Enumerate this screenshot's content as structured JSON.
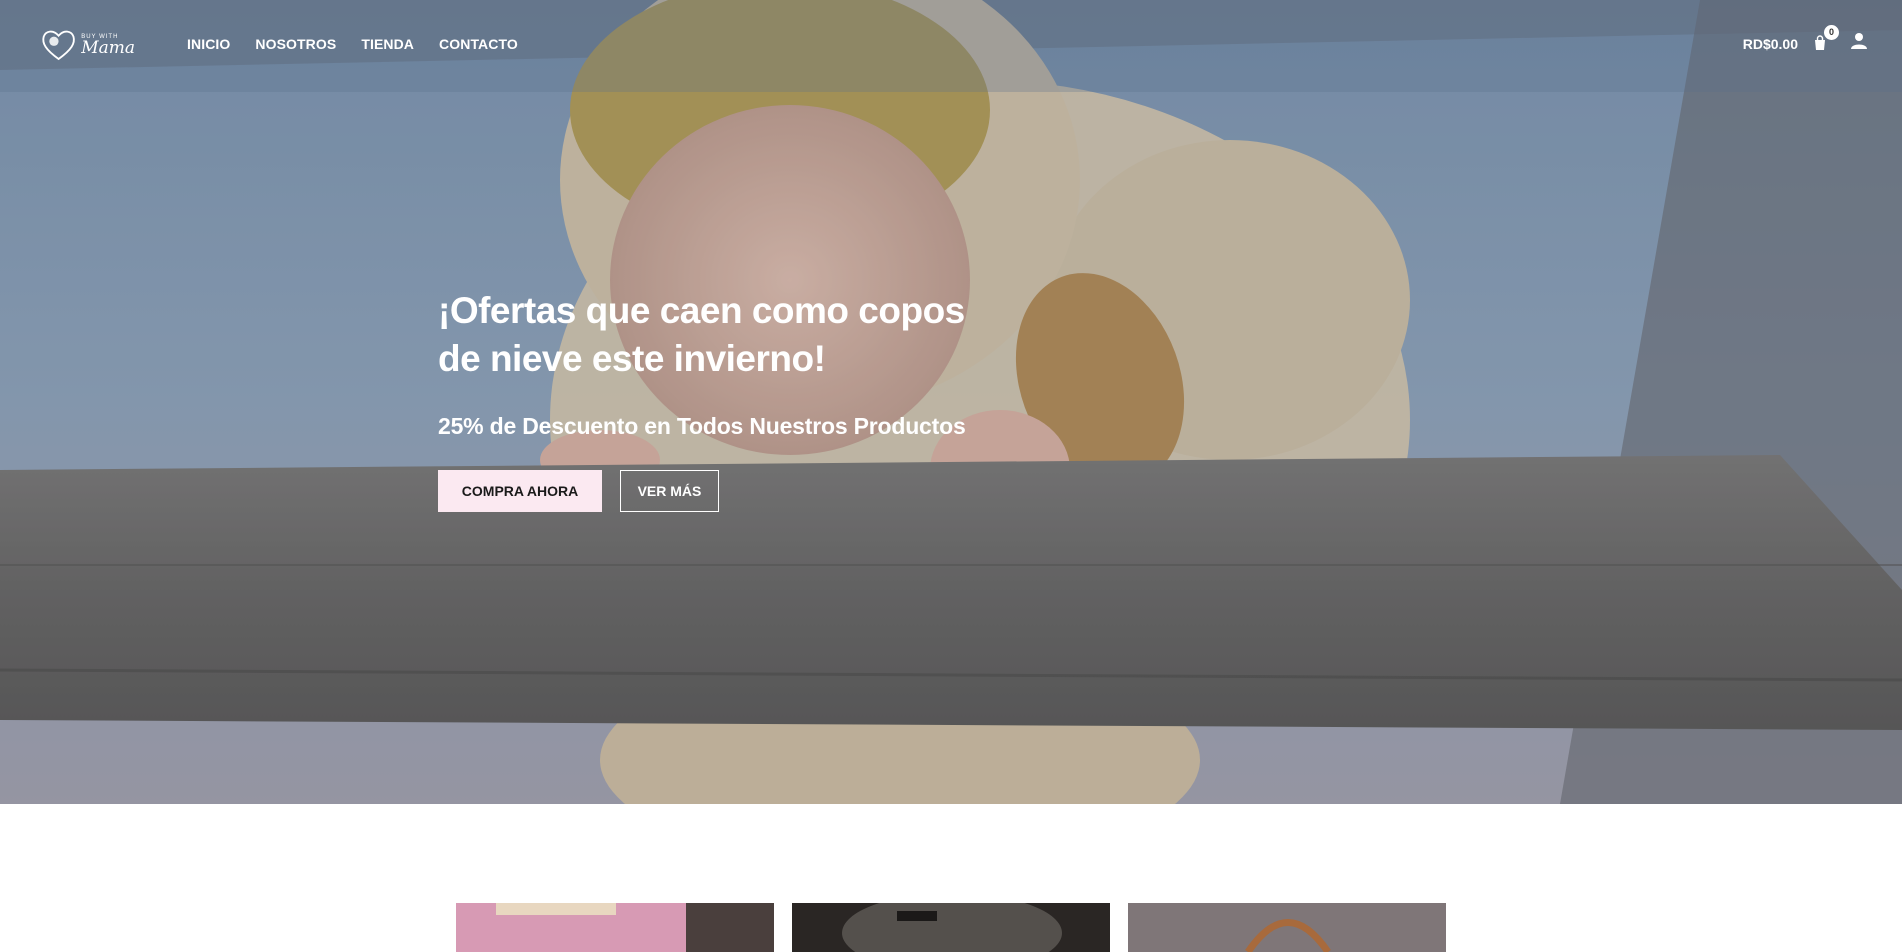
{
  "header": {
    "logo": {
      "tagline": "BUY WITH",
      "name": "Mama",
      "icon": "heart-logo-icon"
    },
    "nav": [
      {
        "label": "INICIO"
      },
      {
        "label": "NOSOTROS"
      },
      {
        "label": "TIENDA"
      },
      {
        "label": "CONTACTO"
      }
    ],
    "cart_total": "RD$0.00",
    "cart_count": "0",
    "icons": {
      "cart": "shopping-bag-icon",
      "account": "user-icon"
    }
  },
  "hero": {
    "title_line1": "¡Ofertas que caen como copos",
    "title_line2": "de nieve este invierno!",
    "subtitle": "25% de Descuento en Todos Nuestros Productos",
    "primary_button": "COMPRA AHORA",
    "secondary_button": "VER MÁS"
  },
  "colors": {
    "primary_button_bg": "#fbe9f1",
    "text_on_hero": "#ffffff"
  }
}
